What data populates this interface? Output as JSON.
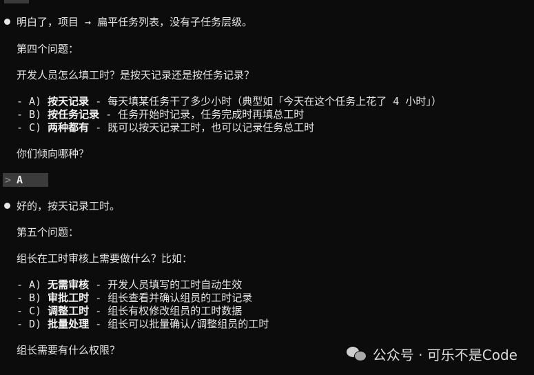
{
  "messages": [
    {
      "text": "明白了，项目 → 扁平任务列表，没有子任务层级。"
    },
    {
      "text": "第四个问题："
    },
    {
      "text": "开发人员怎么填工时？是按天记录还是按任务记录？"
    },
    {
      "options": [
        {
          "key": "- A)",
          "title": "按天记录",
          "desc": " - 每天填某任务干了多少小时（典型如「今天在这个任务上花了 4 小时」）"
        },
        {
          "key": "- B)",
          "title": "按任务记录",
          "desc": " - 任务开始时记录，任务完成时再填总工时"
        },
        {
          "key": "- C)",
          "title": "两种都有",
          "desc": " - 既可以按天记录工时，也可以记录任务总工时"
        }
      ]
    },
    {
      "text": "你们倾向哪种？"
    }
  ],
  "user_input": {
    "prompt_symbol": ">",
    "answer": "A"
  },
  "reply": {
    "lead": "好的，按天记录工时。",
    "heading": "第五个问题：",
    "question": "组长在工时审核上需要做什么？比如：",
    "options": [
      {
        "key": "- A)",
        "title": "无需审核",
        "desc": " - 开发人员填写的工时自动生效"
      },
      {
        "key": "- B)",
        "title": "审批工时",
        "desc": " - 组长查看并确认组员的工时记录"
      },
      {
        "key": "- C)",
        "title": "调整工时",
        "desc": " - 组长有权修改组员的工时数据"
      },
      {
        "key": "- D)",
        "title": "批量处理",
        "desc": " - 组长可以批量确认/调整组员的工时"
      }
    ],
    "closing": "组长需要有什么权限？"
  },
  "watermark": {
    "text": "公众号 · 可乐不是Code",
    "icon": "wechat-icon"
  }
}
